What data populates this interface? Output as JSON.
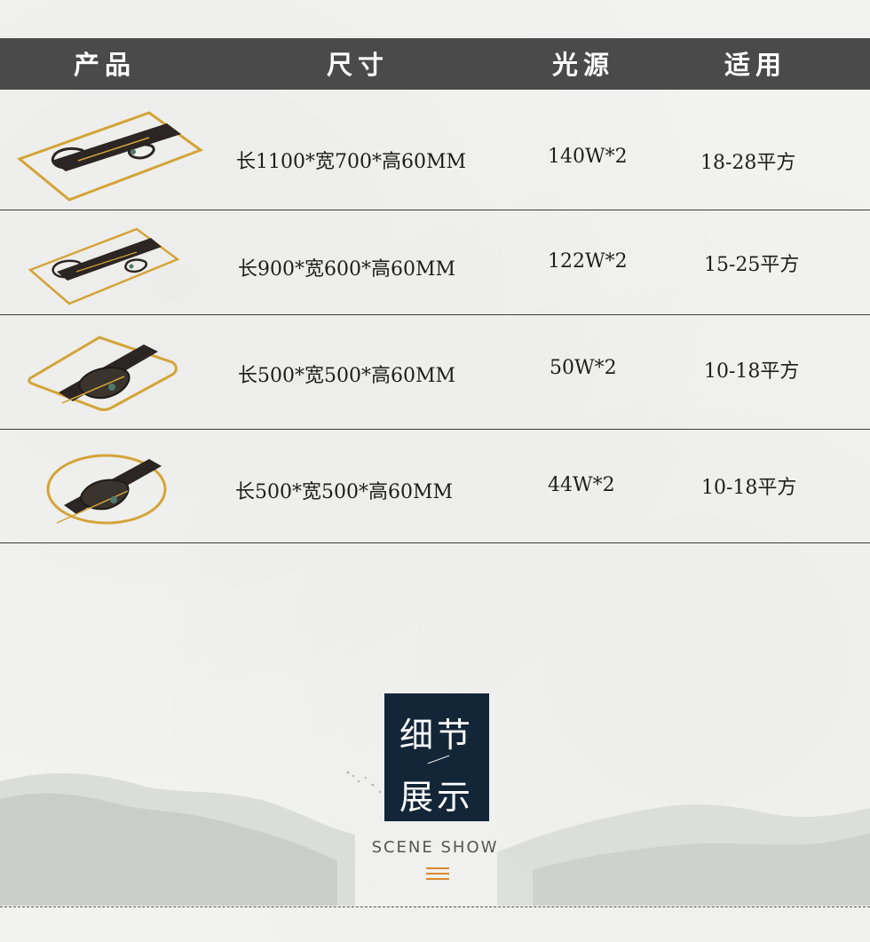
{
  "table": {
    "headers": [
      "产品",
      "尺寸",
      "光源",
      "适用"
    ],
    "rows": [
      {
        "size": "长1100*宽700*高60MM",
        "light": "140W*2",
        "area": "18-28平方"
      },
      {
        "size": "长900*宽600*高60MM",
        "light": "122W*2",
        "area": "15-25平方"
      },
      {
        "size": "长500*宽500*高60MM",
        "light": "50W*2",
        "area": "10-18平方"
      },
      {
        "size": "长500*宽500*高60MM",
        "light": "44W*2",
        "area": "10-18平方"
      }
    ]
  },
  "section": {
    "title_line1": "细节",
    "title_line2": "展示",
    "subtitle": "SCENE SHOW"
  },
  "icons": {
    "menu": "menu-lines-icon",
    "products": [
      "rectangular-ceiling-lamp-icon",
      "rectangular-ceiling-lamp-icon",
      "square-ceiling-lamp-icon",
      "round-ceiling-lamp-icon"
    ]
  },
  "colors": {
    "header_bg": "#4a4a4a",
    "badge_bg": "#132638",
    "gold": "#d4a437",
    "accent": "#d88a2c"
  }
}
